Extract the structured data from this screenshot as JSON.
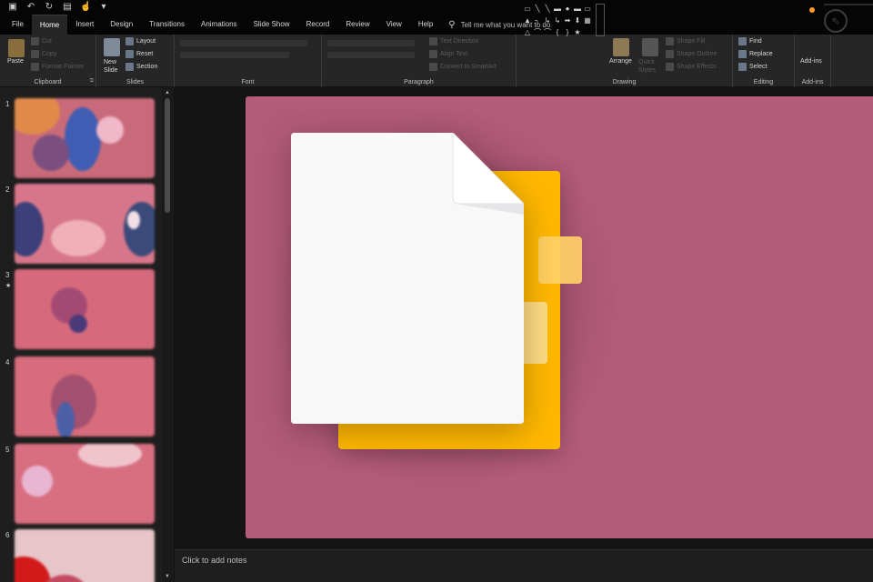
{
  "tabs": [
    {
      "label": "File"
    },
    {
      "label": "Home"
    },
    {
      "label": "Insert"
    },
    {
      "label": "Design"
    },
    {
      "label": "Transitions"
    },
    {
      "label": "Animations"
    },
    {
      "label": "Slide Show"
    },
    {
      "label": "Record"
    },
    {
      "label": "Review"
    },
    {
      "label": "View"
    },
    {
      "label": "Help"
    }
  ],
  "tell_me": "Tell me what you want to do",
  "ribbon": {
    "clipboard": {
      "label": "Clipboard",
      "paste": "Paste",
      "cut": "Cut",
      "copy": "Copy",
      "format_painter": "Format Painter"
    },
    "slides": {
      "label": "Slides",
      "new_slide": "New Slide",
      "layout": "Layout",
      "reset": "Reset",
      "section": "Section"
    },
    "font": {
      "label": "Font"
    },
    "paragraph": {
      "label": "Paragraph",
      "text_direction": "Text Direction",
      "align_text": "Align Text",
      "smartart": "Convert to SmartArt"
    },
    "drawing": {
      "label": "Drawing",
      "arrange": "Arrange",
      "quick_styles": "Quick Styles",
      "shape_fill": "Shape Fill",
      "shape_outline": "Shape Outline",
      "shape_effects": "Shape Effects"
    },
    "editing": {
      "label": "Editing",
      "find": "Find",
      "replace": "Replace",
      "select": "Select"
    },
    "addins": {
      "label": "Add-ins",
      "addins_button": "Add-ins"
    }
  },
  "slides": [
    {
      "number": "1"
    },
    {
      "number": "2"
    },
    {
      "number": "3",
      "marker": "★"
    },
    {
      "number": "4"
    },
    {
      "number": "5"
    },
    {
      "number": "6"
    }
  ],
  "notes_placeholder": "Click to add notes",
  "colors": {
    "slide_background": "#b35b78",
    "doc_back": "#ffb800",
    "doc_front": "#f8f8f9",
    "addin_accent": "#ff9a2e"
  }
}
